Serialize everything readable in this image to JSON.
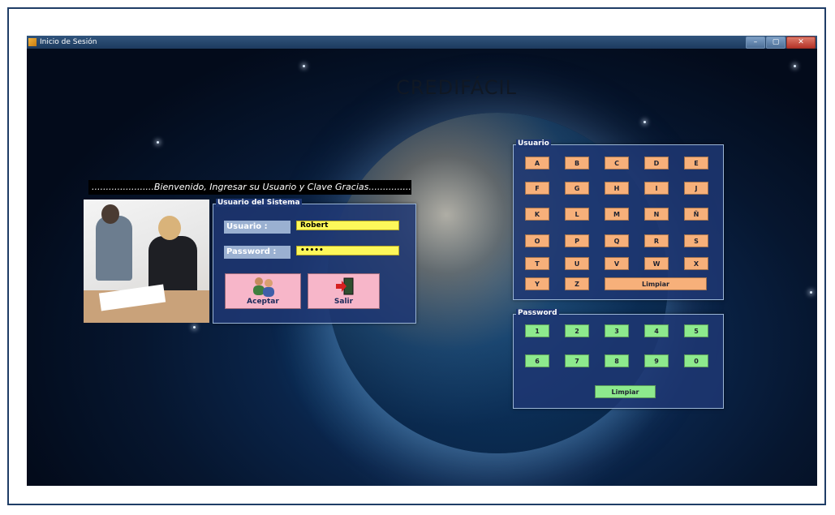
{
  "window": {
    "title": "Inicio de Sesión",
    "buttons": [
      "–",
      "▢",
      "✕"
    ]
  },
  "app_title": "CREDIFÁCIL",
  "welcome_text": "......................Bienvenido, Ingresar su Usuario y Clave Gracias..................",
  "login": {
    "group_label": "Usuario del Sistema",
    "user_label": "Usuario :",
    "user_value": "Robert",
    "password_label": "Password :",
    "password_value": "•••••",
    "accept_label": "Aceptar",
    "exit_label": "Salir"
  },
  "user_keypad": {
    "group_label": "Usuario",
    "keys": [
      "A",
      "B",
      "C",
      "D",
      "E",
      "F",
      "G",
      "H",
      "I",
      "J",
      "K",
      "L",
      "M",
      "N",
      "Ñ",
      "O",
      "P",
      "Q",
      "R",
      "S",
      "T",
      "U",
      "V",
      "W",
      "X",
      "Y",
      "Z"
    ],
    "clear_label": "Limpiar"
  },
  "password_keypad": {
    "group_label": "Password",
    "keys": [
      "1",
      "2",
      "3",
      "4",
      "5",
      "6",
      "7",
      "8",
      "9",
      "0"
    ],
    "clear_label": "Limpiar"
  },
  "colors": {
    "key_letters": "#f7b07a",
    "key_numbers": "#8dea8d",
    "input_bg": "#fdf85a",
    "action_button": "#f7b6c9"
  }
}
